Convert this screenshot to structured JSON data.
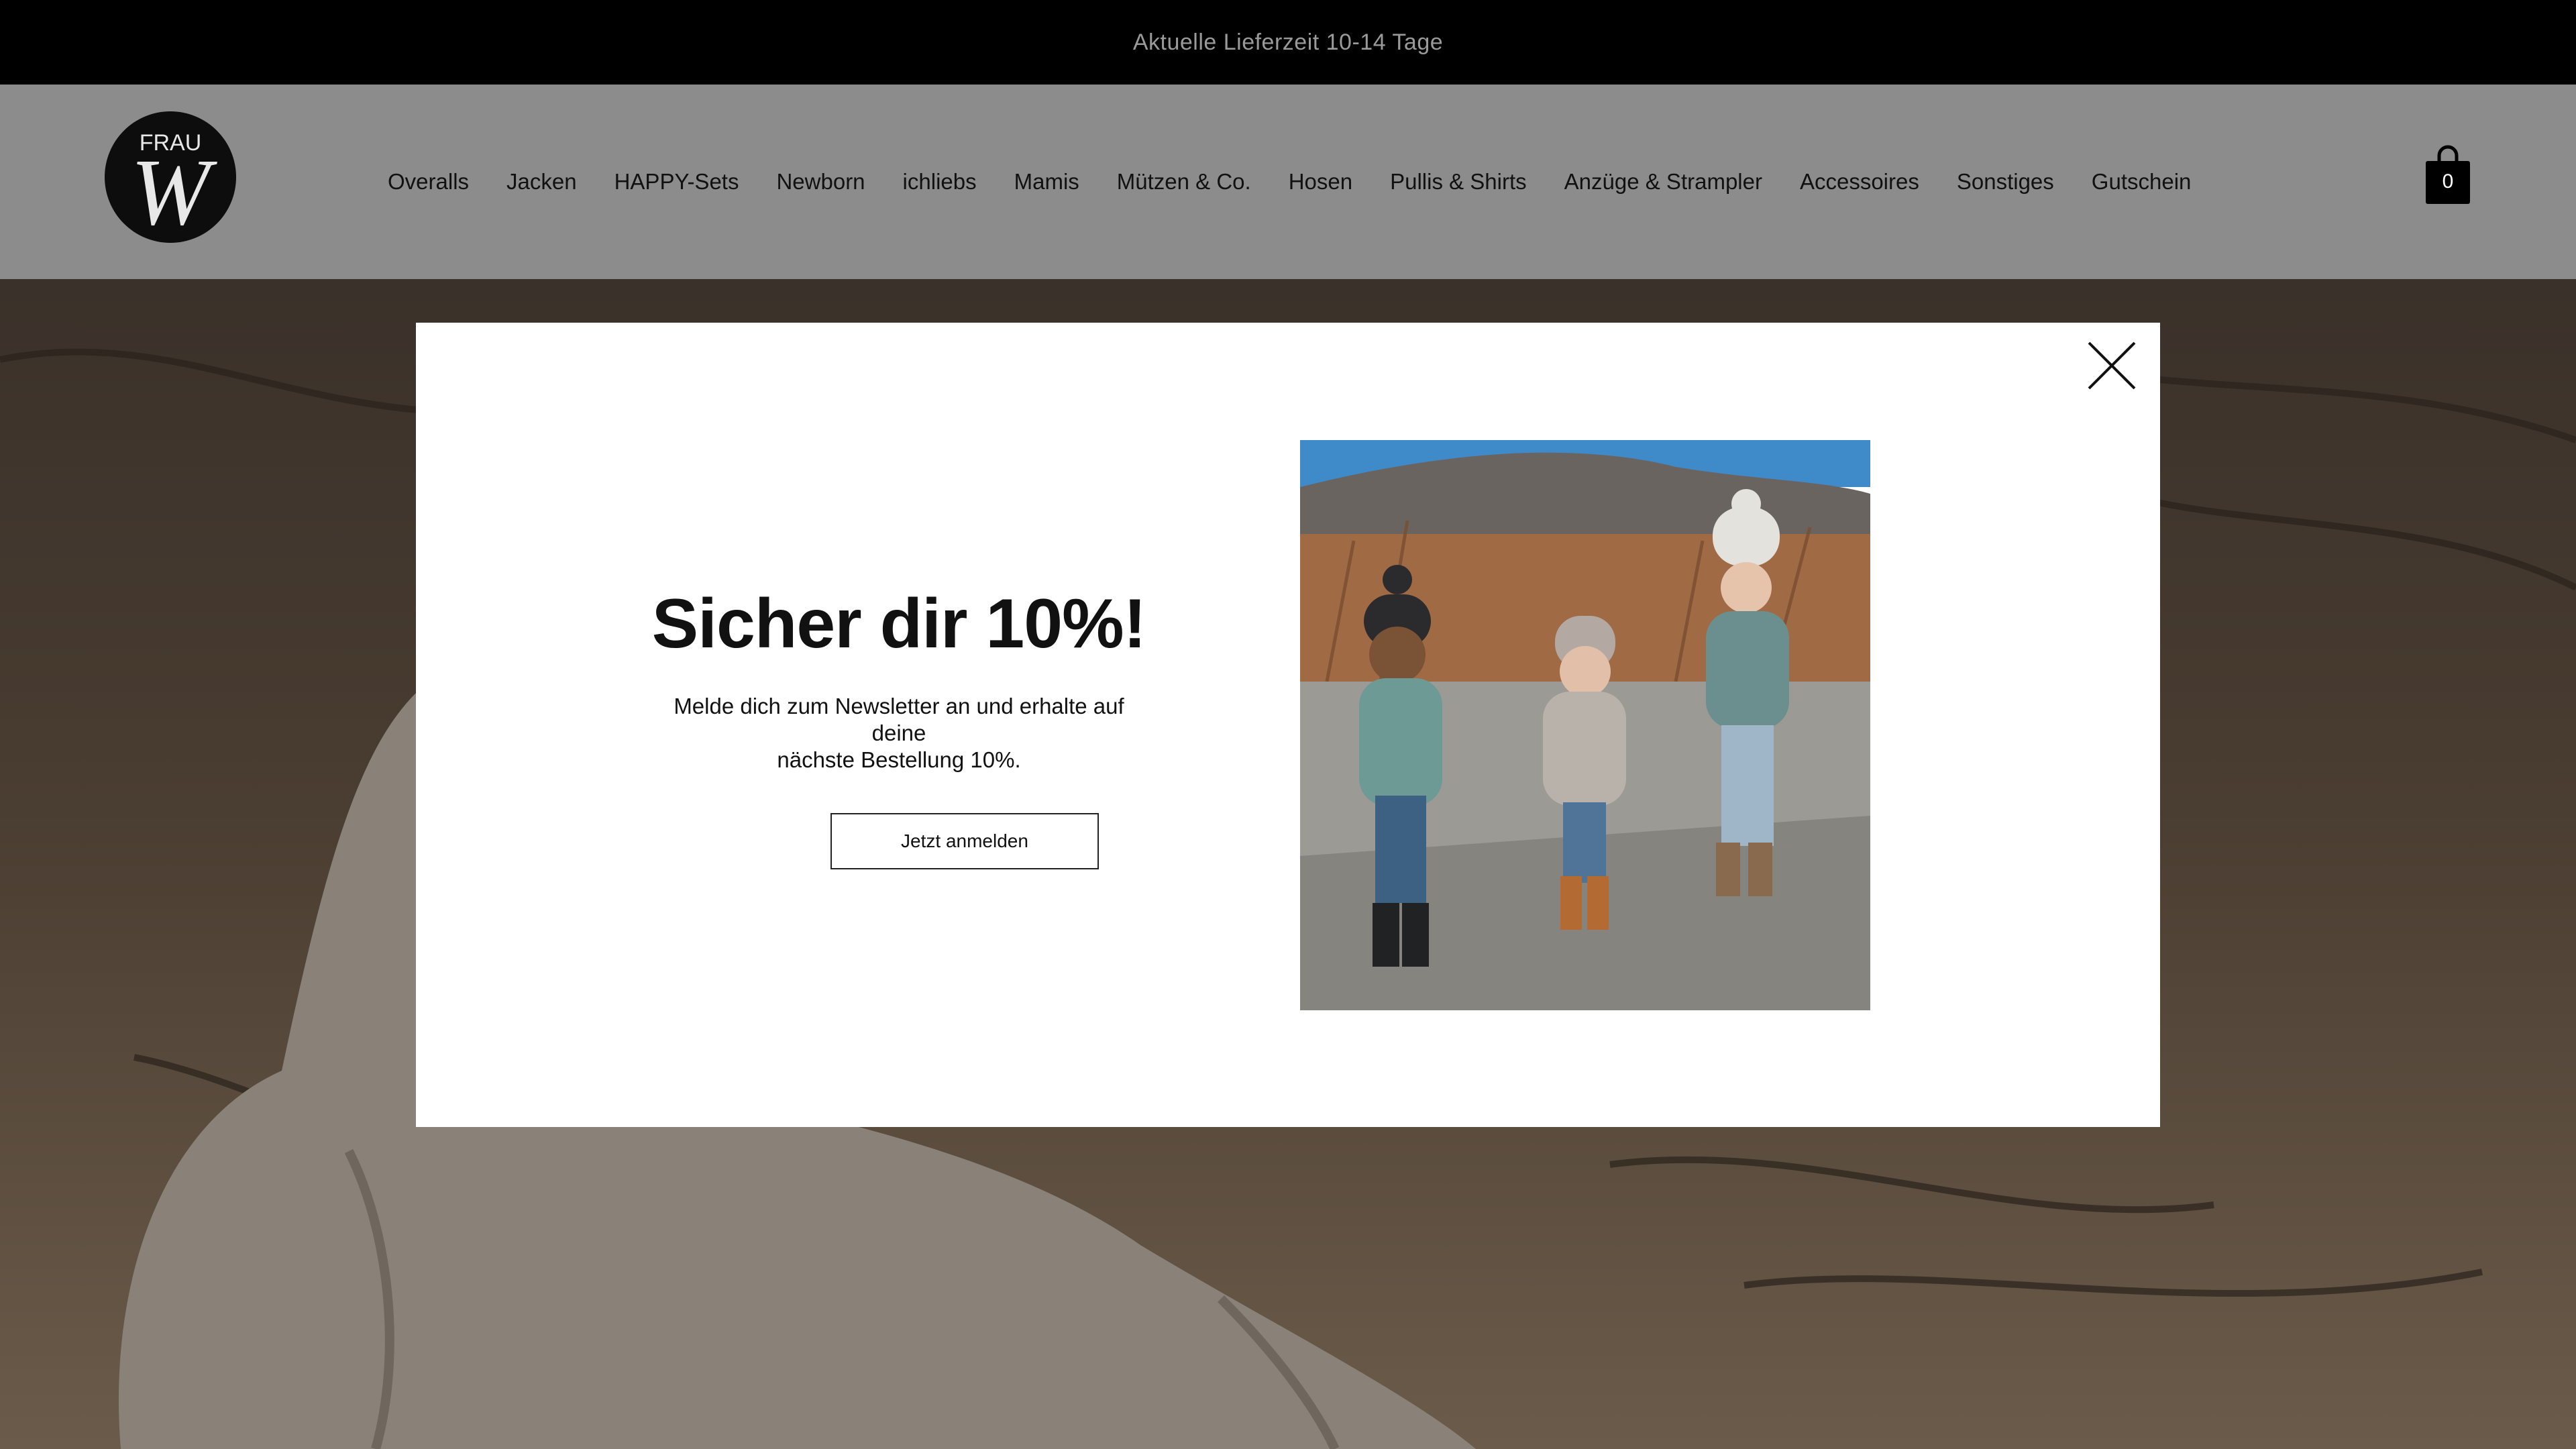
{
  "topbar": {
    "text": "Aktuelle Lieferzeit  10-14 Tage"
  },
  "logo": {
    "top_text": "FRAU",
    "letter": "W"
  },
  "nav": {
    "items": [
      {
        "label": "Overalls"
      },
      {
        "label": "Jacken"
      },
      {
        "label": "HAPPY-Sets"
      },
      {
        "label": "Newborn"
      },
      {
        "label": "ichliebs"
      },
      {
        "label": "Mamis"
      },
      {
        "label": "Mützen & Co."
      },
      {
        "label": "Hosen"
      },
      {
        "label": "Pullis & Shirts"
      },
      {
        "label": "Anzüge & Strampler"
      },
      {
        "label": "Accessoires"
      },
      {
        "label": "Sonstiges"
      },
      {
        "label": "Gutschein"
      }
    ]
  },
  "cart": {
    "count": "0",
    "icon": "shopping-bag-icon"
  },
  "popup": {
    "headline": "Sicher dir 10%!",
    "body_line1": "Melde dich zum Newsletter an und erhalte auf deine",
    "body_line2": "nächste Bestellung 10%.",
    "button_label": "Jetzt anmelden",
    "close_icon": "close-icon"
  },
  "colors": {
    "topbar_bg": "#000000",
    "header_bg": "#8c8c8c",
    "modal_bg": "#ffffff"
  }
}
